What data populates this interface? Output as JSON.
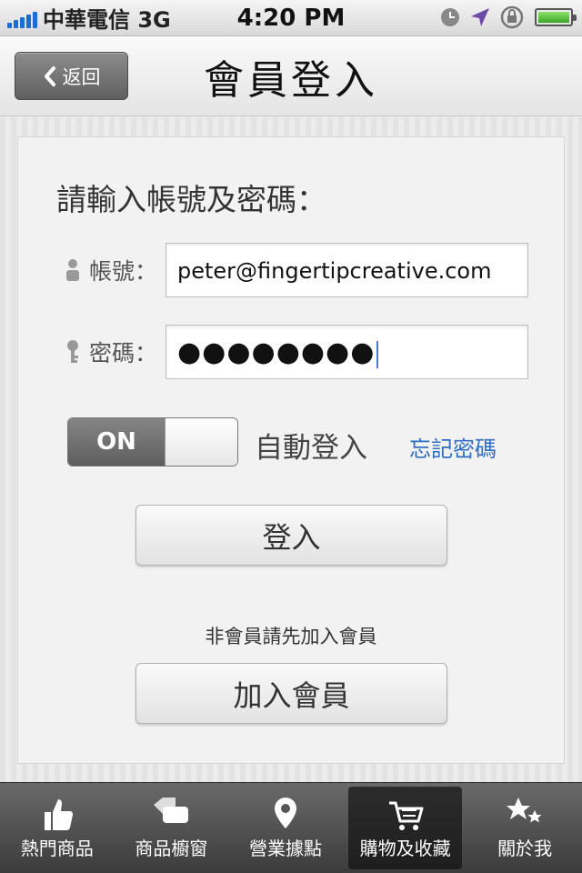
{
  "status_bar": {
    "carrier": "中華電信 3G",
    "time": "4:20 PM"
  },
  "nav": {
    "back_label": "返回",
    "title": "會員登入"
  },
  "form": {
    "prompt": "請輸入帳號及密碼：",
    "account_label": "帳號：",
    "account_value": "peter@fingertipcreative.com",
    "password_label": "密碼：",
    "password_value": "●●●●●●●●",
    "toggle_state": "ON",
    "auto_login_label": "自動登入",
    "forgot_password": "忘記密碼",
    "login_button": "登入",
    "member_note": "非會員請先加入會員",
    "join_button": "加入會員"
  },
  "tabs": [
    {
      "label": "熱門商品",
      "icon": "thumbs-up-icon",
      "active": false
    },
    {
      "label": "商品櫥窗",
      "icon": "tags-icon",
      "active": false
    },
    {
      "label": "營業據點",
      "icon": "location-pin-icon",
      "active": false
    },
    {
      "label": "購物及收藏",
      "icon": "cart-icon",
      "active": true
    },
    {
      "label": "關於我",
      "icon": "stars-icon",
      "active": false
    }
  ],
  "colors": {
    "accent_link": "#2f6ec4",
    "signal": "#1a6cd6",
    "battery": "#3aa52a"
  }
}
